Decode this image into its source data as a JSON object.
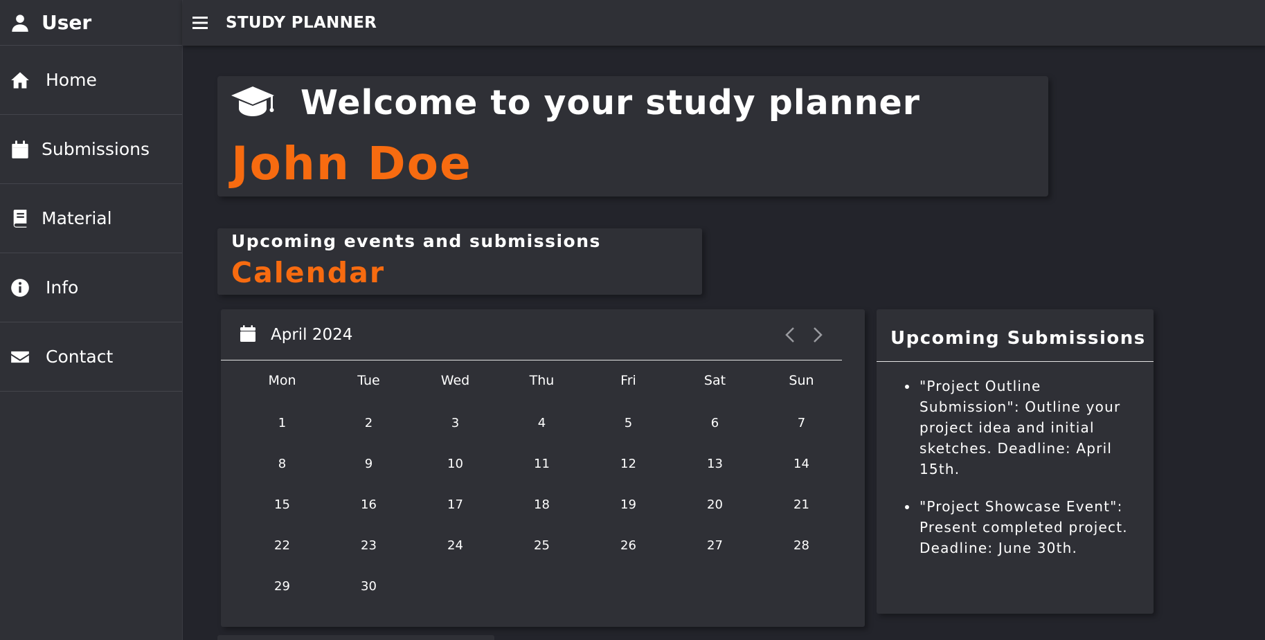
{
  "sidebar": {
    "user_label": "User",
    "items": [
      {
        "label": "Home",
        "icon": "home-icon"
      },
      {
        "label": "Submissions",
        "icon": "calendar-icon"
      },
      {
        "label": "Material",
        "icon": "book-icon"
      },
      {
        "label": "Info",
        "icon": "info-icon"
      },
      {
        "label": "Contact",
        "icon": "envelope-icon"
      }
    ]
  },
  "topbar": {
    "title": "STUDY PLANNER",
    "menu_icon": "menu-icon"
  },
  "welcome": {
    "title": "Welcome to your study planner",
    "user_name": "John Doe",
    "icon": "graduation-cap-icon"
  },
  "section": {
    "subtitle": "Upcoming events and submissions",
    "title": "Calendar"
  },
  "calendar": {
    "month_label": "April 2024",
    "weekdays": [
      "Mon",
      "Tue",
      "Wed",
      "Thu",
      "Fri",
      "Sat",
      "Sun"
    ],
    "days": [
      "1",
      "2",
      "3",
      "4",
      "5",
      "6",
      "7",
      "8",
      "9",
      "10",
      "11",
      "12",
      "13",
      "14",
      "15",
      "16",
      "17",
      "18",
      "19",
      "20",
      "21",
      "22",
      "23",
      "24",
      "25",
      "26",
      "27",
      "28",
      "29",
      "30"
    ]
  },
  "submissions": {
    "title": "Upcoming Submissions",
    "items": [
      "\"Project Outline Submission\": Outline your project idea and initial sketches. Deadline: April 15th.",
      "\"Project Showcase Event\": Present completed project. Deadline: June 30th."
    ]
  },
  "colors": {
    "accent": "#f76b10",
    "panel": "#2f3036",
    "background": "#23242b"
  }
}
